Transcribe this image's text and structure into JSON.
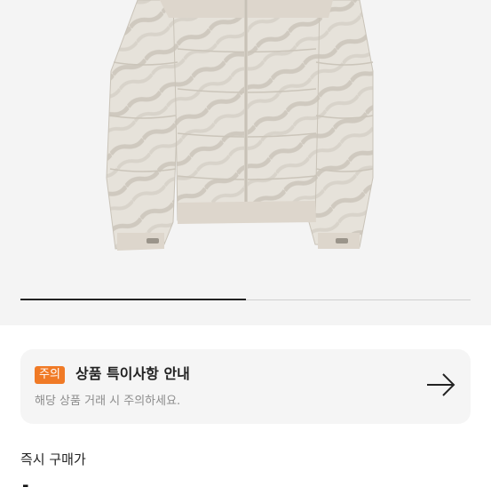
{
  "notice": {
    "badge": "주의",
    "title": "상품 특이사항 안내",
    "subtitle": "해당 상품 거래 시 주의하세요."
  },
  "instant_buy": {
    "label": "즉시 구매가",
    "price": "-"
  },
  "gallery": {
    "progress_fraction": 0.5
  },
  "icons": {
    "notice_arrow": "arrow-right-icon"
  },
  "colors": {
    "badge_bg": "#f07a26",
    "progress_fill": "#222222"
  }
}
